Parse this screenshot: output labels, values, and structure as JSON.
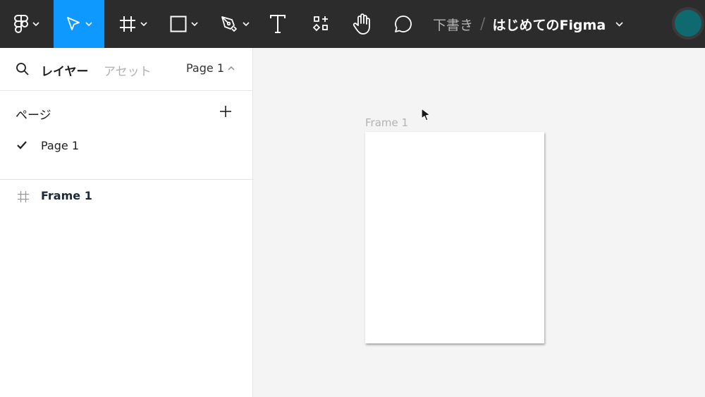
{
  "toolbar": {
    "tools": [
      {
        "id": "main-menu",
        "icon": "figma-logo-icon",
        "has_dropdown": true
      },
      {
        "id": "move",
        "icon": "move-pointer-icon",
        "has_dropdown": true,
        "active": true
      },
      {
        "id": "frame",
        "icon": "frame-hash-icon",
        "has_dropdown": true
      },
      {
        "id": "shape",
        "icon": "rectangle-icon",
        "has_dropdown": true
      },
      {
        "id": "pen",
        "icon": "pen-icon",
        "has_dropdown": true
      },
      {
        "id": "text",
        "icon": "text-icon",
        "has_dropdown": false
      },
      {
        "id": "resources",
        "icon": "resources-icon",
        "has_dropdown": false
      },
      {
        "id": "hand",
        "icon": "hand-icon",
        "has_dropdown": false
      },
      {
        "id": "comment",
        "icon": "comment-icon",
        "has_dropdown": false
      }
    ],
    "breadcrumb": {
      "draft": "下書き",
      "separator": "/",
      "file_name": "はじめてのFigma"
    },
    "active_color": "#0d99ff",
    "background_color": "#2c2c2c",
    "avatar_color": "#0e6a6e"
  },
  "left_panel": {
    "tabs": {
      "layers": "レイヤー",
      "assets": "アセット",
      "page_select": "Page 1"
    },
    "pages": {
      "title": "ページ",
      "items": [
        {
          "label": "Page 1",
          "selected": true
        }
      ]
    },
    "layers": [
      {
        "label": "Frame 1",
        "icon": "frame-hash-icon"
      }
    ]
  },
  "canvas": {
    "frame_label": "Frame 1",
    "background_color": "#f4f4f4"
  }
}
